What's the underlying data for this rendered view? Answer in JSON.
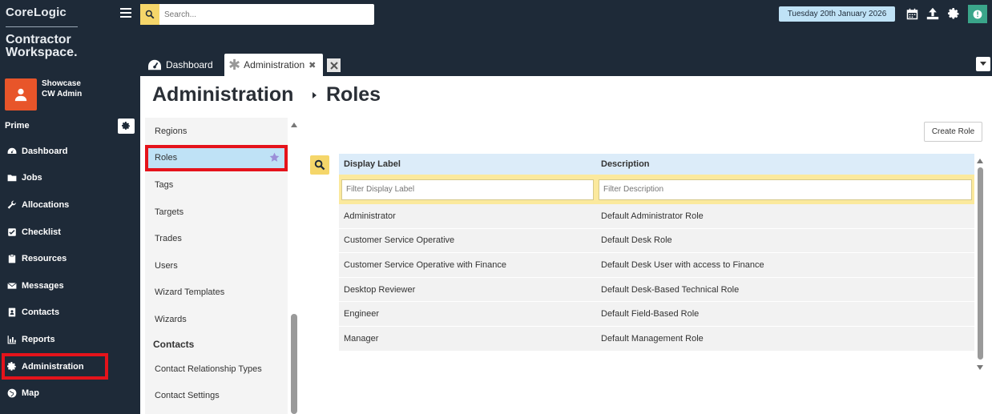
{
  "brand": {
    "line1": "CoreLogic",
    "line2a": "Contractor",
    "line2b": "Workspace."
  },
  "user": {
    "name": "Showcase",
    "role": "CW Admin"
  },
  "section_label": "Prime",
  "nav": {
    "items": [
      {
        "label": "Dashboard",
        "icon": "dashboard-gauge-icon"
      },
      {
        "label": "Jobs",
        "icon": "folder-icon"
      },
      {
        "label": "Allocations",
        "icon": "wrench-icon"
      },
      {
        "label": "Checklist",
        "icon": "checkbox-icon"
      },
      {
        "label": "Resources",
        "icon": "clipboard-icon"
      },
      {
        "label": "Messages",
        "icon": "envelope-icon"
      },
      {
        "label": "Contacts",
        "icon": "address-book-icon"
      },
      {
        "label": "Reports",
        "icon": "bar-chart-icon"
      },
      {
        "label": "Administration",
        "icon": "gear-icon"
      },
      {
        "label": "Map",
        "icon": "globe-icon"
      }
    ],
    "active": "Administration"
  },
  "search": {
    "placeholder": "Search..."
  },
  "date": "Tuesday 20th January 2026",
  "tabs": [
    {
      "label": "Dashboard",
      "icon": "gauge-icon"
    },
    {
      "label": "Administration",
      "icon": "asterisk-icon"
    }
  ],
  "page": {
    "title": "Administration",
    "subtitle": "Roles"
  },
  "subnav": {
    "items": [
      "Regions",
      "Roles",
      "Tags",
      "Targets",
      "Trades",
      "Users",
      "Wizard Templates",
      "Wizards"
    ],
    "selected": "Roles",
    "section": "Contacts",
    "section_items": [
      "Contact Relationship Types",
      "Contact Settings"
    ]
  },
  "create_button": "Create Role",
  "grid": {
    "columns": [
      "Display Label",
      "Description"
    ],
    "filters": [
      "Filter Display Label",
      "Filter Description"
    ],
    "rows": [
      [
        "Administrator",
        "Default Administrator Role"
      ],
      [
        "Customer Service Operative",
        "Default Desk Role"
      ],
      [
        "Customer Service Operative with Finance",
        "Default Desk User with access to Finance"
      ],
      [
        "Desktop Reviewer",
        "Default Desk-Based Technical Role"
      ],
      [
        "Engineer",
        "Default Field-Based Role"
      ],
      [
        "Manager",
        "Default Management Role"
      ]
    ]
  },
  "colors": {
    "sidebar": "#1e2a38",
    "accent_yellow": "#f5d66a",
    "selected_blue": "#bfe2f6",
    "highlight_red": "#e5131b",
    "avatar": "#e8552a",
    "info": "#3aa58a"
  }
}
